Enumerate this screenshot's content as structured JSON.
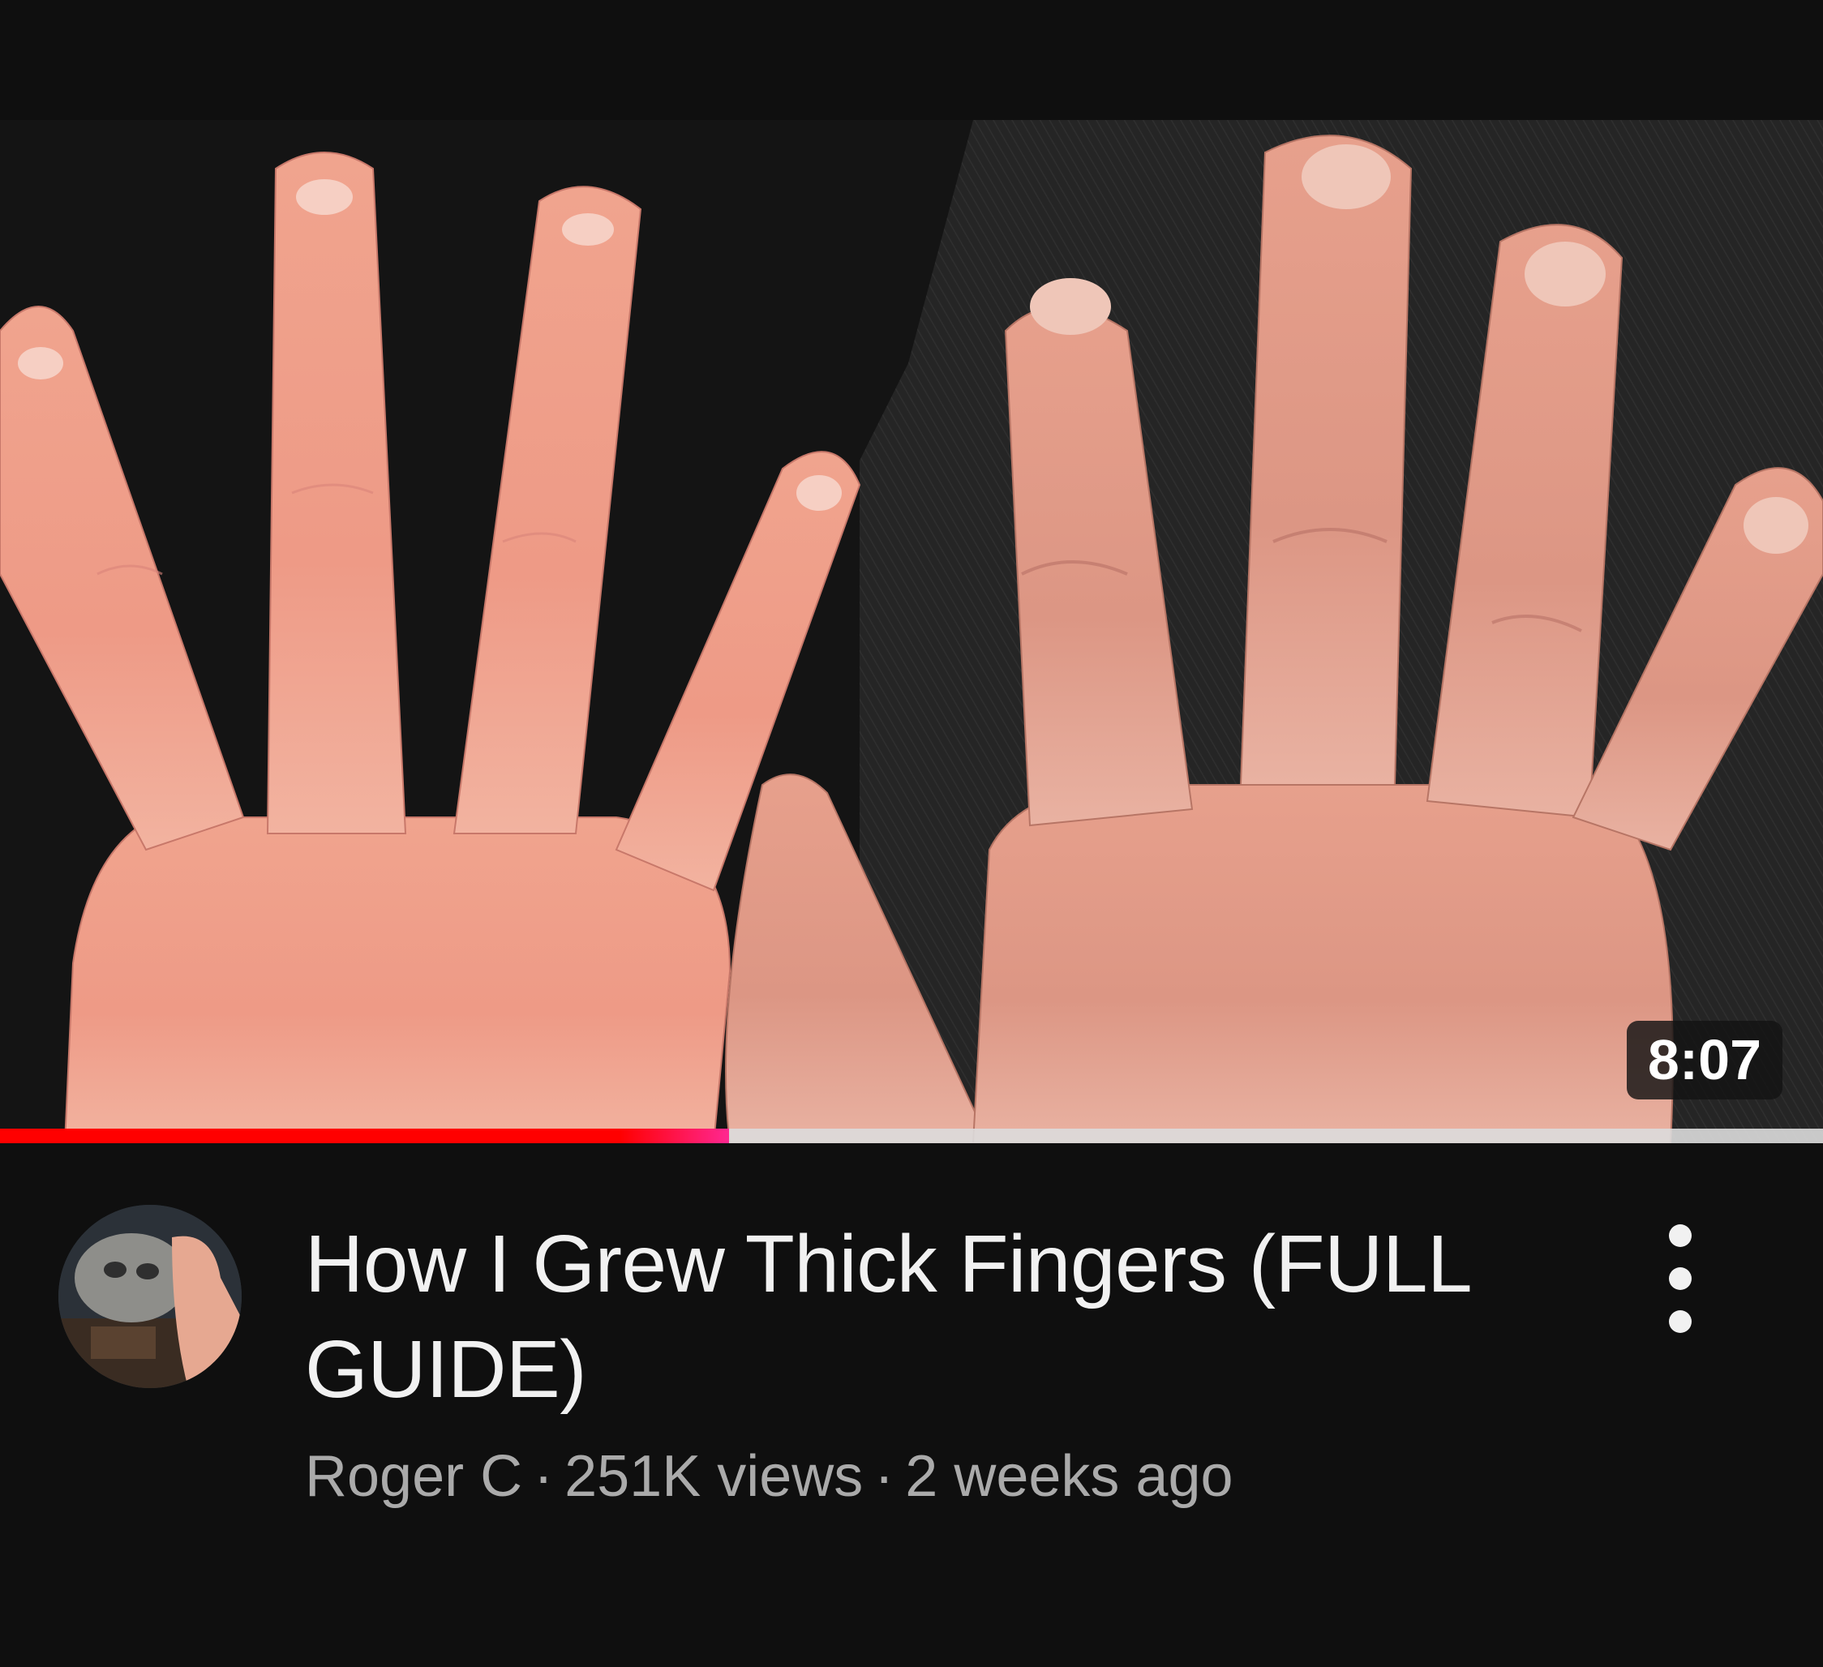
{
  "video": {
    "duration": "8:07",
    "progress_fraction": 0.4,
    "title": "How I Grew Thick Fingers (FULL GUIDE)",
    "channel": "Roger C",
    "views": "251K views",
    "age": "2 weeks ago",
    "separator": "·"
  },
  "icons": {
    "more": "more-vert-icon"
  },
  "colors": {
    "background": "#0f0f0f",
    "progress_played": "#ff0000",
    "progress_track": "#dcdcdc",
    "title_text": "#f1f1f1",
    "meta_text": "#aaaaaa"
  }
}
